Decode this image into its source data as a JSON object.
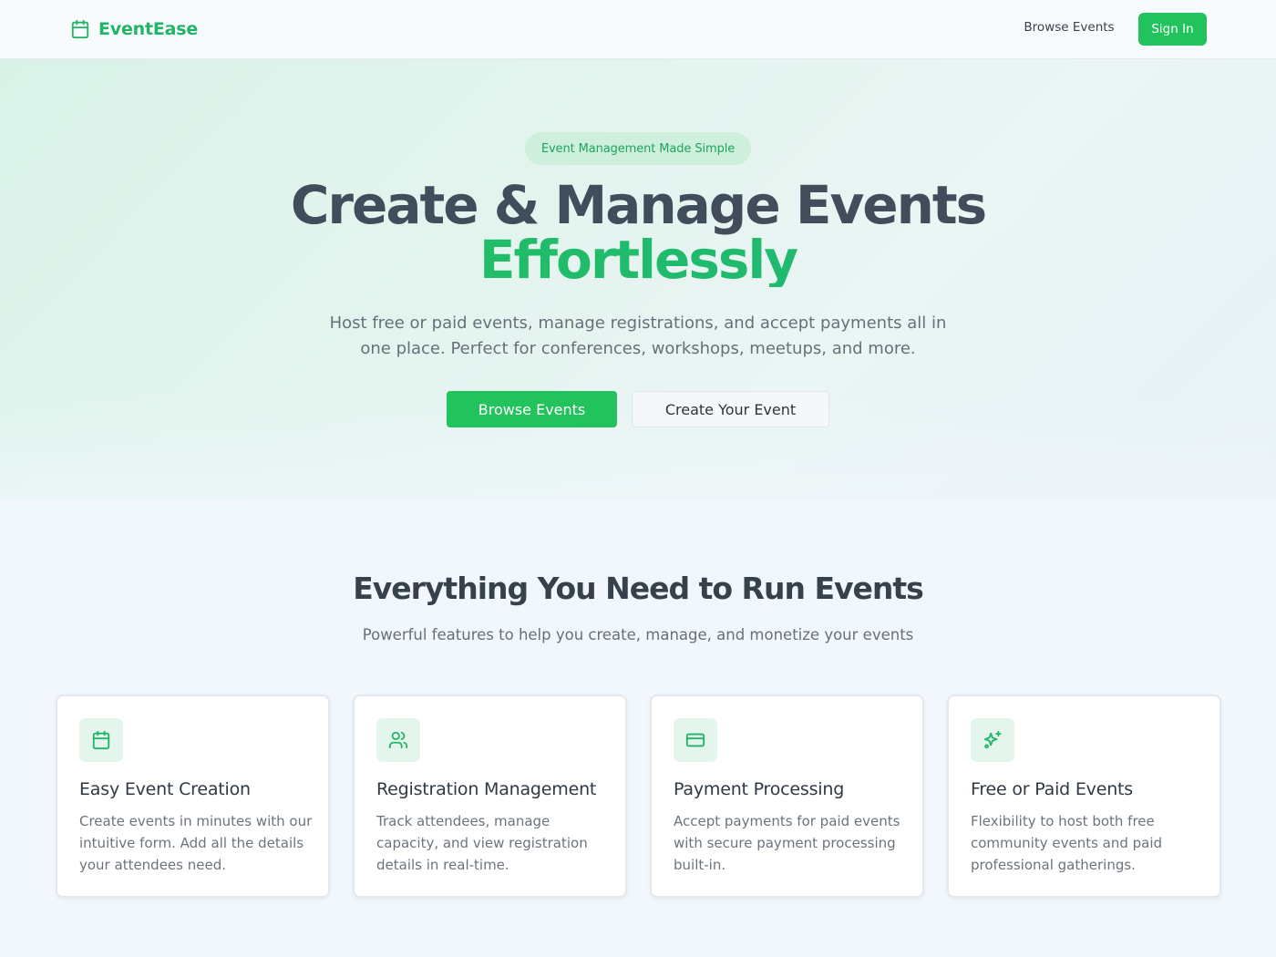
{
  "nav": {
    "brand": "EventEase",
    "brand_icon": "calendar-icon",
    "browse_label": "Browse Events",
    "signin_label": "Sign In"
  },
  "hero": {
    "badge": "Event Management Made Simple",
    "title_line1": "Create & Manage Events",
    "title_line2": "Effortlessly",
    "subtitle": "Host free or paid events, manage registrations, and accept payments all in one place. Perfect for conferences, workshops, meetups, and more.",
    "primary_button": "Browse Events",
    "secondary_button": "Create Your Event"
  },
  "features": {
    "title": "Everything You Need to Run Events",
    "subtitle": "Powerful features to help you create, manage, and monetize your events",
    "cards": [
      {
        "icon": "calendar-icon",
        "title": "Easy Event Creation",
        "description": "Create events in minutes with our intuitive form. Add all the details your attendees need."
      },
      {
        "icon": "users-icon",
        "title": "Registration Management",
        "description": "Track attendees, manage capacity, and view registration details in real-time."
      },
      {
        "icon": "credit-card-icon",
        "title": "Payment Processing",
        "description": "Accept payments for paid events with secure payment processing built-in."
      },
      {
        "icon": "sparkles-icon",
        "title": "Free or Paid Events",
        "description": "Flexibility to host both free community events and paid professional gatherings."
      }
    ]
  },
  "colors": {
    "brand": "#22c25c",
    "icon_bg": "#e4f6ec",
    "heading": "#414d5a"
  }
}
